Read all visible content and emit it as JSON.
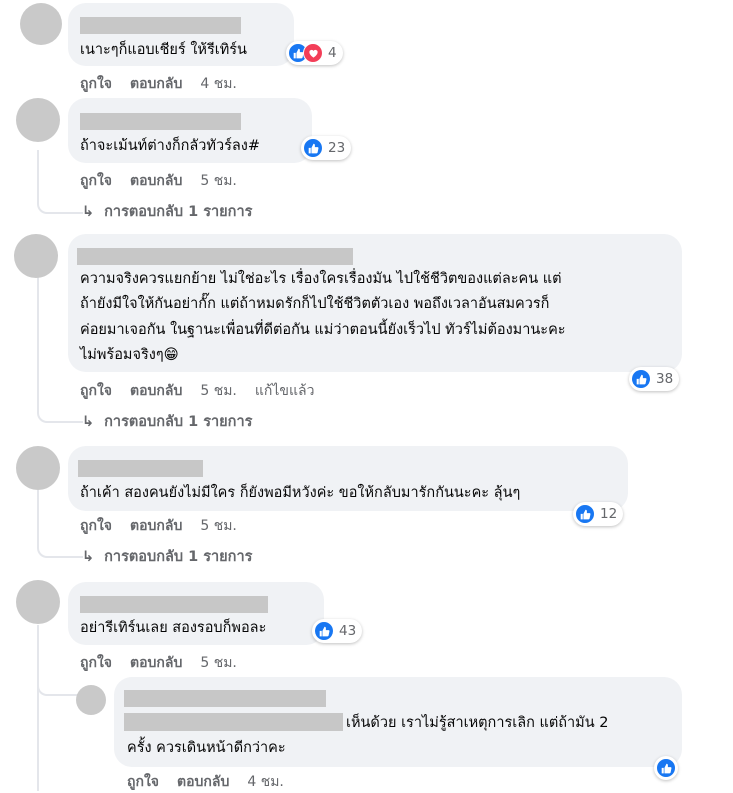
{
  "actions": {
    "like": "ถูกใจ",
    "reply": "ตอบกลับ",
    "edited": "แก้ไขแล้ว"
  },
  "comments": [
    {
      "text": "เนาะๆก็แอบเชียร์ ให้รีเทิร์น",
      "time": "4 ชม.",
      "reactions": {
        "types": [
          "like-icon",
          "love-icon"
        ],
        "count": "4"
      }
    },
    {
      "text": "ถ้าจะเม้นท์ต่างก็กลัวทัวร์ลง#",
      "time": "5 ชม.",
      "reactions": {
        "types": [
          "like-icon"
        ],
        "count": "23"
      },
      "replies_label": "การตอบกลับ 1 รายการ"
    },
    {
      "lines": [
        "ความจริงควรแยกย้าย ไม่ใช่อะไร เรื่องใครเรื่องมัน ไปใช้ชีวิตของแต่ละคน แต่",
        "ถ้ายังมีใจให้กันอย่ากั๊ก แต่ถ้าหมดรักก็ไปใช้ชีวิตตัวเอง พอถึงเวลาอันสมควรก็",
        "ค่อยมาเจอกัน ในฐานะเพื่อนที่ดีต่อกัน แม่ว่าตอนนี้ยังเร็วไป ทัวร์ไม่ต้องมานะคะ",
        "ไม่พร้อมจริงๆ😁"
      ],
      "time": "5 ชม.",
      "reactions": {
        "types": [
          "like-icon"
        ],
        "count": "38"
      },
      "replies_label": "การตอบกลับ 1 รายการ"
    },
    {
      "text": "ถ้าเค้า สองคนยังไม่มีใคร ก็ยังพอมีหวังค่ะ ขอให้กลับมารักกันนะคะ ลุ้นๆ",
      "time": "5 ชม.",
      "reactions": {
        "types": [
          "like-icon"
        ],
        "count": "12"
      },
      "replies_label": "การตอบกลับ 1 รายการ"
    },
    {
      "text": "อย่ารีเทิร์นเลย สองรอบก็พอละ",
      "time": "5 ชม.",
      "reactions": {
        "types": [
          "like-icon"
        ],
        "count": "43"
      }
    }
  ],
  "reply": {
    "lines": [
      "เห็นด้วย เราไม่รู้สาเหตุการเลิก แต่ถ้ามัน 2",
      "ครั้ง ควรเดินหน้าดีกว่าคะ"
    ],
    "time": "4 ชม.",
    "reactions": {
      "types": [
        "like-icon"
      ]
    }
  },
  "colors": {
    "bubble": "#f0f2f5",
    "like": "#1877f2",
    "love": "#f33e58",
    "muted": "#65676b",
    "redacted": "#c7c7c7"
  }
}
